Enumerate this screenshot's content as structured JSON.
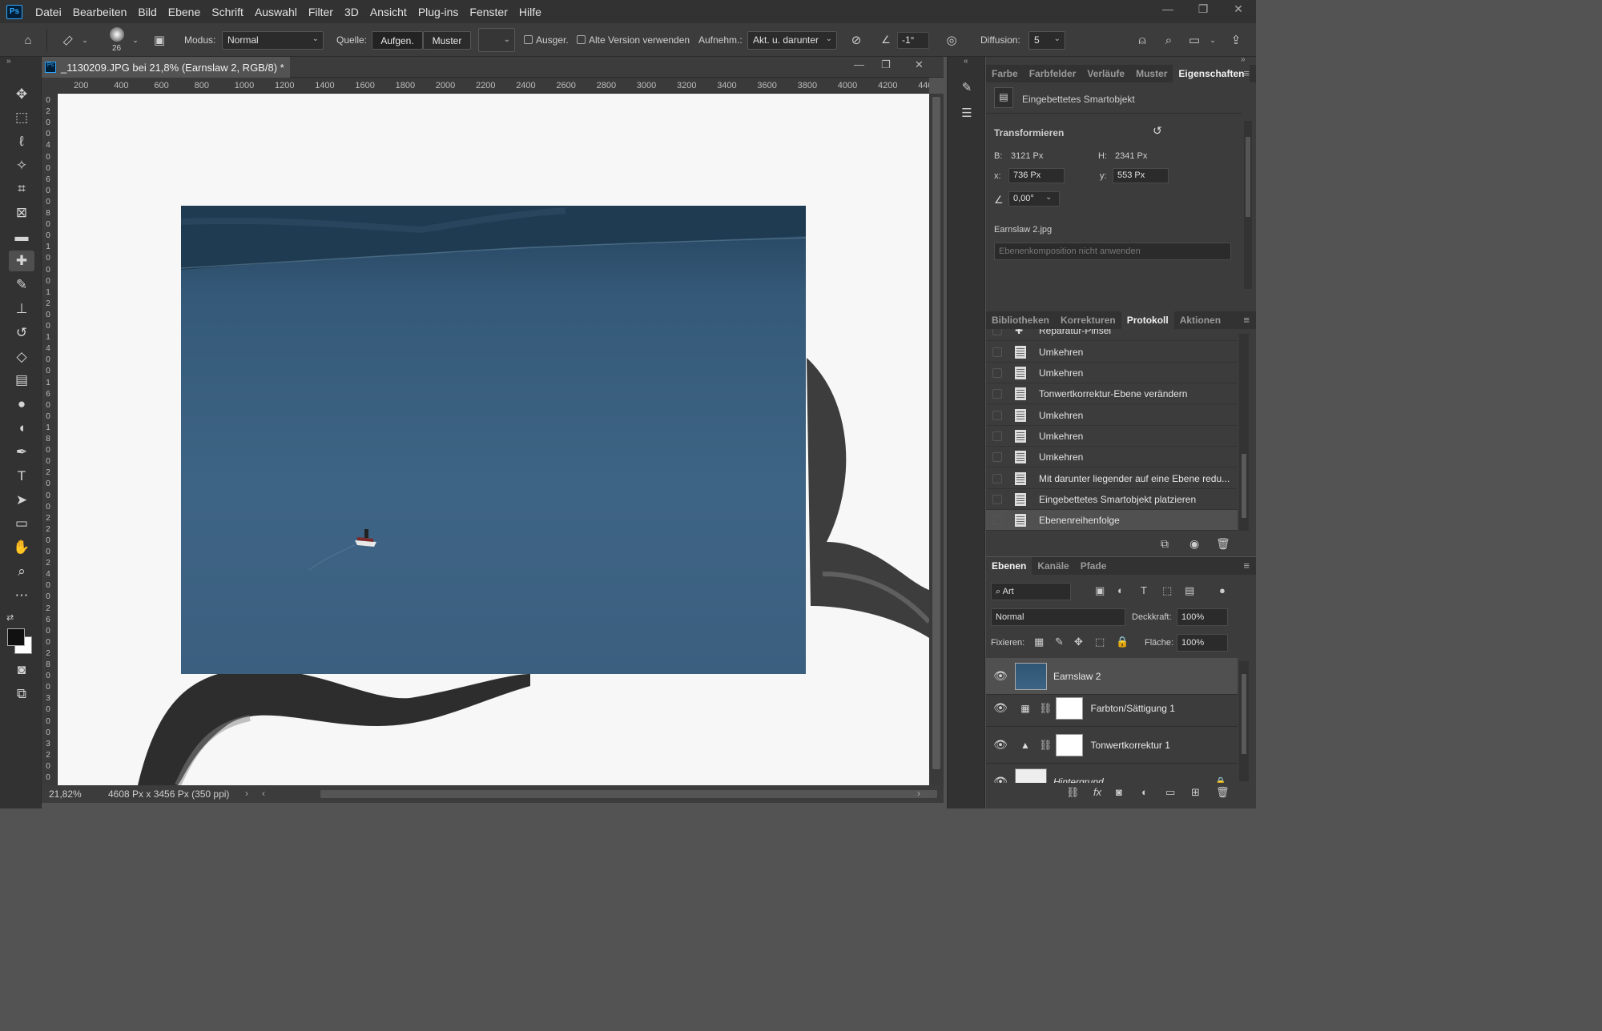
{
  "app": {
    "logo": "Ps"
  },
  "menu": [
    "Datei",
    "Bearbeiten",
    "Bild",
    "Ebene",
    "Schrift",
    "Auswahl",
    "Filter",
    "3D",
    "Ansicht",
    "Plug-ins",
    "Fenster",
    "Hilfe"
  ],
  "window_controls": {
    "minimize": "—",
    "maximize": "❐",
    "close": "✕"
  },
  "options": {
    "brush_size": "26",
    "modus_label": "Modus:",
    "modus_value": "Normal",
    "quelle_label": "Quelle:",
    "aufgen_label": "Aufgen.",
    "muster_label": "Muster",
    "ausger_label": "Ausger.",
    "alte_version_label": "Alte Version verwenden",
    "aufnehm_label": "Aufnehm.:",
    "aufnehm_value": "Akt. u. darunter",
    "angle_value": "-1°",
    "diffusion_label": "Diffusion:",
    "diffusion_value": "5"
  },
  "document": {
    "title": "_1130209.JPG bei 21,8% (Earnslaw 2, RGB/8) *",
    "ruler_h": [
      "200",
      "400",
      "600",
      "800",
      "1000",
      "1200",
      "1400",
      "1600",
      "1800",
      "2000",
      "2200",
      "2400",
      "2600",
      "2800",
      "3000",
      "3200",
      "3400",
      "3600",
      "3800",
      "4000",
      "4200",
      "440"
    ],
    "ruler_v": [
      "0",
      "2",
      "0",
      "0",
      "4",
      "0",
      "0",
      "6",
      "0",
      "0",
      "8",
      "0",
      "0",
      "1",
      "0",
      "0",
      "0",
      "1",
      "2",
      "0",
      "0",
      "1",
      "4",
      "0",
      "0",
      "1",
      "6",
      "0",
      "0",
      "1",
      "8",
      "0",
      "0",
      "2",
      "0",
      "0",
      "0",
      "2",
      "2",
      "0",
      "0",
      "2",
      "4",
      "0",
      "0",
      "2",
      "6",
      "0",
      "0",
      "2",
      "8",
      "0",
      "0",
      "3",
      "0",
      "0",
      "0",
      "3",
      "2",
      "0",
      "0",
      "3"
    ],
    "zoom": "21,82%",
    "info": "4608 Px x 3456 Px (350 ppi)"
  },
  "properties_panel": {
    "tabs": [
      "Farbe",
      "Farbfelder",
      "Verläufe",
      "Muster",
      "Eigenschaften"
    ],
    "active_tab": "Eigenschaften",
    "object_type": "Eingebettetes Smartobjekt",
    "section": "Transformieren",
    "b_label": "B:",
    "b_value": "3121 Px",
    "h_label": "H:",
    "h_value": "2341 Px",
    "x_label": "x:",
    "x_value": "736 Px",
    "y_label": "y:",
    "y_value": "553 Px",
    "angle": "0,00°",
    "filename": "Earnslaw 2.jpg",
    "comp_placeholder": "Ebenenkomposition nicht anwenden"
  },
  "history_panel": {
    "tabs": [
      "Bibliotheken",
      "Korrekturen",
      "Protokoll",
      "Aktionen"
    ],
    "active_tab": "Protokoll",
    "partial_item": "Reparatur-Pinsel",
    "items": [
      "Umkehren",
      "Umkehren",
      "Tonwertkorrektur-Ebene verändern",
      "Umkehren",
      "Umkehren",
      "Umkehren",
      "Mit darunter liegender auf eine Ebene redu...",
      "Eingebettetes Smartobjekt platzieren",
      "Ebenenreihenfolge"
    ]
  },
  "layers_panel": {
    "tabs": [
      "Ebenen",
      "Kanäle",
      "Pfade"
    ],
    "active_tab": "Ebenen",
    "filter_value": "Art",
    "blend_mode": "Normal",
    "opacity_label": "Deckkraft:",
    "opacity_value": "100%",
    "lock_label": "Fixieren:",
    "fill_label": "Fläche:",
    "fill_value": "100%",
    "layers": [
      "Earnslaw 2",
      "Farbton/Sättigung 1",
      "Tonwertkorrektur 1",
      "Hintergrund"
    ]
  },
  "colors": {
    "accent": "#31a8ff",
    "panel_bg": "#3c3c3c",
    "dark_bg": "#323232",
    "canvas_bg": "#535353"
  }
}
